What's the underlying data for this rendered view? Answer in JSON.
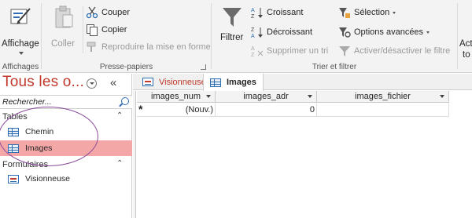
{
  "ribbon": {
    "affichage": {
      "label": "Affichage",
      "group": "Affichages"
    },
    "clipboard": {
      "paste": "Coller",
      "cut": "Couper",
      "copy": "Copier",
      "format_painter": "Reproduire la mise en forme",
      "group": "Presse-papiers"
    },
    "sort_filter": {
      "filter": "Filtrer",
      "ascending": "Croissant",
      "descending": "Décroissant",
      "remove_sort": "Supprimer un tri",
      "selection": "Sélection",
      "advanced": "Options avancées",
      "toggle_filter": "Activer/désactiver le filtre",
      "group": "Trier et filtrer"
    },
    "cut_off": {
      "line1": "Act",
      "line2": "to"
    }
  },
  "nav": {
    "title": "Tous les o...",
    "collapse_glyph": "«",
    "search_placeholder": "Rechercher...",
    "sections": [
      {
        "label": "Tables",
        "items": [
          {
            "label": "Chemin"
          },
          {
            "label": "Images",
            "selected": true
          }
        ]
      },
      {
        "label": "Formulaires",
        "items": [
          {
            "label": "Visionneuse"
          }
        ]
      }
    ],
    "chevron_up": "⌃"
  },
  "tabs": [
    {
      "label": "Visionneuse",
      "active": false
    },
    {
      "label": "Images",
      "active": true
    }
  ],
  "grid": {
    "columns": [
      "images_num",
      "images_adr",
      "images_fichier"
    ],
    "new_row": {
      "marker": "*",
      "images_num": "(Nouv.)",
      "images_adr": "0",
      "images_fichier": ""
    }
  },
  "colors": {
    "accent": "#c0392b",
    "selected_bg": "#f4a7a7",
    "annotation": "#8a4a9b"
  }
}
